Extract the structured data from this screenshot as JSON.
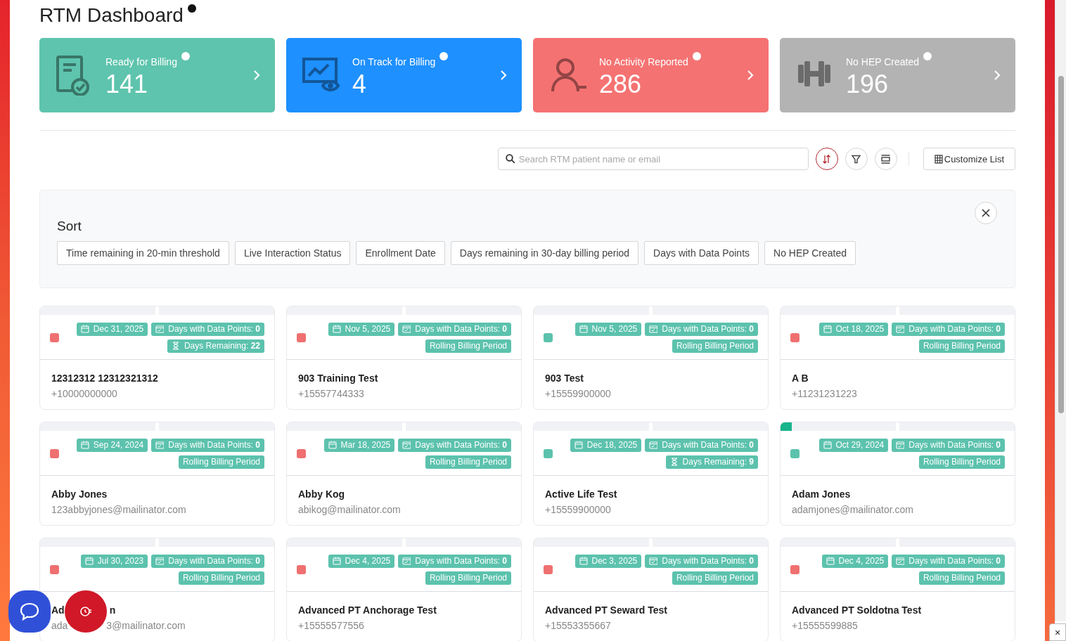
{
  "title": "RTM Dashboard",
  "stats": [
    {
      "label": "Ready for Billing",
      "value": "141",
      "color": "#5ec4ad"
    },
    {
      "label": "On Track for Billing",
      "value": "4",
      "color": "#1e90ff"
    },
    {
      "label": "No Activity Reported",
      "value": "286",
      "color": "#f57272"
    },
    {
      "label": "No HEP Created",
      "value": "196",
      "color": "#b3b3b3"
    }
  ],
  "search": {
    "placeholder": "Search RTM patient name or email"
  },
  "toolbar": [
    {
      "kind": "sort",
      "selected": true
    },
    {
      "kind": "filter",
      "selected": false
    },
    {
      "kind": "layout",
      "selected": false
    }
  ],
  "customize_button": "Customize List",
  "sort_panel": {
    "title": "Sort",
    "options": [
      "Time remaining in 20-min threshold",
      "Live Interaction Status",
      "Enrollment Date",
      "Days remaining in 30-day billing period",
      "Days with Data Points",
      "No HEP Created"
    ]
  },
  "patients": [
    {
      "color": "#ef7070",
      "highlight": false,
      "tags": [
        {
          "kind": "date",
          "text": "Dec 31, 2025"
        },
        {
          "kind": "data",
          "text": "Days with Data Points: **0**"
        },
        {
          "kind": "remaining",
          "text": "Days Remaining: **22**"
        }
      ],
      "name": [
        "12312312 12312321312"
      ],
      "contact": [
        "+10000000000"
      ]
    },
    {
      "color": "#ef7070",
      "highlight": false,
      "tags": [
        {
          "kind": "date",
          "text": "Nov 5, 2025"
        },
        {
          "kind": "data",
          "text": "Days with Data Points: **0**"
        },
        {
          "kind": "period",
          "text": "Rolling Billing Period"
        }
      ],
      "name": [
        "903 Training Test"
      ],
      "contact": [
        "+15557744333"
      ]
    },
    {
      "color": "#5cc2ad",
      "highlight": false,
      "tags": [
        {
          "kind": "date",
          "text": "Nov 5, 2025"
        },
        {
          "kind": "data",
          "text": "Days with Data Points: **0**"
        },
        {
          "kind": "period",
          "text": "Rolling Billing Period"
        }
      ],
      "name": [
        "903 Test"
      ],
      "contact": [
        "+15559900000"
      ]
    },
    {
      "color": "#ef7070",
      "highlight": false,
      "tags": [
        {
          "kind": "date",
          "text": "Oct 18, 2025"
        },
        {
          "kind": "data",
          "text": "Days with Data Points: **0**"
        },
        {
          "kind": "period",
          "text": "Rolling Billing Period"
        }
      ],
      "name": [
        "A B"
      ],
      "contact": [
        "+11231231223"
      ]
    },
    {
      "color": "#ef7070",
      "highlight": false,
      "tags": [
        {
          "kind": "date",
          "text": "Sep 24, 2024"
        },
        {
          "kind": "data",
          "text": "Days with Data Points: **0**"
        },
        {
          "kind": "period",
          "text": "Rolling Billing Period"
        }
      ],
      "name": [
        "Abby Jones"
      ],
      "contact": [
        "123abbyjones@mailinator.com"
      ]
    },
    {
      "color": "#ef7070",
      "highlight": false,
      "tags": [
        {
          "kind": "date",
          "text": "Mar 18, 2025"
        },
        {
          "kind": "data",
          "text": "Days with Data Points: **0**"
        },
        {
          "kind": "period",
          "text": "Rolling Billing Period"
        }
      ],
      "name": [
        "Abby Kog"
      ],
      "contact": [
        "abikog@mailinator.com"
      ]
    },
    {
      "color": "#5cc2ad",
      "highlight": false,
      "tags": [
        {
          "kind": "date",
          "text": "Dec 18, 2025"
        },
        {
          "kind": "data",
          "text": "Days with Data Points: **0**"
        },
        {
          "kind": "remaining",
          "text": "Days Remaining: **9**"
        }
      ],
      "name": [
        "Active Life Test"
      ],
      "contact": [
        "+15559900000"
      ]
    },
    {
      "color": "#5cc2ad",
      "highlight": true,
      "tags": [
        {
          "kind": "date",
          "text": "Oct 29, 2024"
        },
        {
          "kind": "data",
          "text": "Days with Data Points: **0**"
        },
        {
          "kind": "period",
          "text": "Rolling Billing Period"
        }
      ],
      "name": [
        "Adam Jones"
      ],
      "contact": [
        "adamjones@mailinator.com"
      ]
    },
    {
      "color": "#ef7070",
      "highlight": false,
      "tags": [
        {
          "kind": "date",
          "text": "Jul 30, 2023"
        },
        {
          "kind": "data",
          "text": "Days with Data Points: **0**"
        },
        {
          "kind": "period",
          "text": "Rolling Billing Period"
        }
      ],
      "name": [
        "Ad",
        "n"
      ],
      "contact": [
        "ada",
        "3@mailinator.com"
      ]
    },
    {
      "color": "#ef7070",
      "highlight": false,
      "tags": [
        {
          "kind": "date",
          "text": "Dec 4, 2025"
        },
        {
          "kind": "data",
          "text": "Days with Data Points: **0**"
        },
        {
          "kind": "period",
          "text": "Rolling Billing Period"
        }
      ],
      "name": [
        "Advanced PT Anchorage Test"
      ],
      "contact": [
        "+15555577556"
      ]
    },
    {
      "color": "#ef7070",
      "highlight": false,
      "tags": [
        {
          "kind": "date",
          "text": "Dec 3, 2025"
        },
        {
          "kind": "data",
          "text": "Days with Data Points: **0**"
        },
        {
          "kind": "period",
          "text": "Rolling Billing Period"
        }
      ],
      "name": [
        "Advanced PT Seward Test"
      ],
      "contact": [
        "+15553355667"
      ]
    },
    {
      "color": "#ef7070",
      "highlight": false,
      "tags": [
        {
          "kind": "date",
          "text": "Dec 4, 2025"
        },
        {
          "kind": "data",
          "text": "Days with Data Points: **0**"
        },
        {
          "kind": "period",
          "text": "Rolling Billing Period"
        }
      ],
      "name": [
        "Advanced PT Soldotna Test"
      ],
      "contact": [
        "+15555599885"
      ]
    }
  ],
  "corner_close": "×"
}
